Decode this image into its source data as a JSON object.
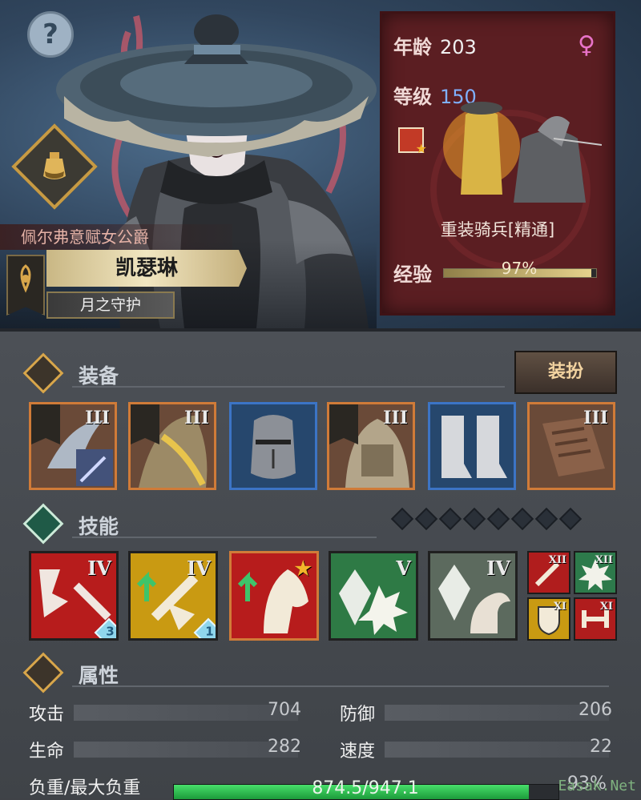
{
  "character": {
    "title": "佩尔弗意赋女公爵",
    "name": "凯瑟琳",
    "subtitle": "月之守护",
    "gender_symbol": "♀"
  },
  "info_panel": {
    "age_label": "年龄",
    "age_value": "203",
    "level_label": "等级",
    "level_value": "150",
    "class_name": "重装骑兵[精通]",
    "exp_label": "经验",
    "exp_percent_text": "97%",
    "exp_fraction": 0.97
  },
  "equipment": {
    "section_title": "装备",
    "dress_button": "装扮",
    "slots": [
      {
        "kind": "weapon-claw",
        "tier": "III",
        "rarity": "orange"
      },
      {
        "kind": "armor-gold",
        "tier": "III",
        "rarity": "orange"
      },
      {
        "kind": "helmet",
        "tier": "",
        "rarity": "blue"
      },
      {
        "kind": "armor-plate",
        "tier": "III",
        "rarity": "orange"
      },
      {
        "kind": "boots",
        "tier": "",
        "rarity": "blue"
      },
      {
        "kind": "book",
        "tier": "III",
        "rarity": "orange"
      }
    ]
  },
  "skills": {
    "section_title": "技能",
    "slots_total": 8,
    "items": [
      {
        "kind": "shattered-spear",
        "tier": "IV",
        "color": "#b71c1c",
        "badge": "3"
      },
      {
        "kind": "sword-up-arrow",
        "tier": "IV",
        "color": "#c99a12",
        "badge": "1"
      },
      {
        "kind": "horse-up",
        "tier": "",
        "color": "#b71c1c",
        "badge": ""
      },
      {
        "kind": "crystal-burst",
        "tier": "V",
        "color": "#2e7a45",
        "badge": ""
      },
      {
        "kind": "crystal-muscle",
        "tier": "IV",
        "color": "#5c6a5e",
        "badge": ""
      }
    ],
    "passives": [
      {
        "kind": "sword",
        "tier": "XII",
        "color": "#b01d1d"
      },
      {
        "kind": "burst",
        "tier": "XII",
        "color": "#2d7a4b"
      },
      {
        "kind": "shield",
        "tier": "XI",
        "color": "#c99a12"
      },
      {
        "kind": "dumbbell",
        "tier": "XI",
        "color": "#b01d1d"
      }
    ]
  },
  "attributes": {
    "section_title": "属性",
    "stats": [
      {
        "label": "攻击",
        "value": "704"
      },
      {
        "label": "防御",
        "value": "206"
      },
      {
        "label": "生命",
        "value": "282"
      },
      {
        "label": "速度",
        "value": "22"
      }
    ],
    "load_label": "负重/最大负重",
    "load_text": "874.5/947.1",
    "load_percent_text": "93%",
    "load_fraction": 0.923
  },
  "watermark": "Easak.Net",
  "colors": {
    "accent_gold": "#d8a64b",
    "panel_red": "#5b1e22",
    "level_blue": "#7fb0ff",
    "load_green": "#2fc352"
  }
}
